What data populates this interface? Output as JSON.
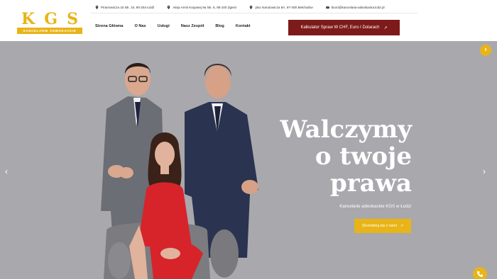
{
  "brand": {
    "letters": [
      "K",
      "G",
      "S"
    ],
    "tagline": "KANCELARIE ADWOKACKIE",
    "accent_color": "#e8b417",
    "dark_red": "#7d1a1a"
  },
  "contact_bar": [
    {
      "icon": "location-pin-icon",
      "text": "Piramowicza 15 lok. 10, 90-254 Łódź"
    },
    {
      "icon": "location-pin-icon",
      "text": "Aleja Armii Krajowej 9a lok. 6, 95-100 Zgierz"
    },
    {
      "icon": "location-pin-icon",
      "text": "plac Narutowicza 8A, 97-400 Bełchatów"
    },
    {
      "icon": "mail-icon",
      "text": "biuro@kancelaria-adwokacka.lodz.pl"
    }
  ],
  "nav": {
    "items": [
      "Strona Główna",
      "O Nas",
      "Usługi",
      "Nasz Zespół",
      "Blog",
      "Kontakt"
    ]
  },
  "header_cta": {
    "label": "Kalkulator Spraw W CHF, Euro I Dolarach",
    "icon": "arrow-up-right-icon"
  },
  "hero": {
    "headline_lines": [
      "Walczymy",
      "o twoje",
      "prawa"
    ],
    "subtitle": "Kancelarie adwokackie KGS w Łodzi",
    "cta_label": "Skontaktuj się z nami",
    "background_color": "#a9a8ad"
  },
  "badge": {
    "text": "0"
  }
}
